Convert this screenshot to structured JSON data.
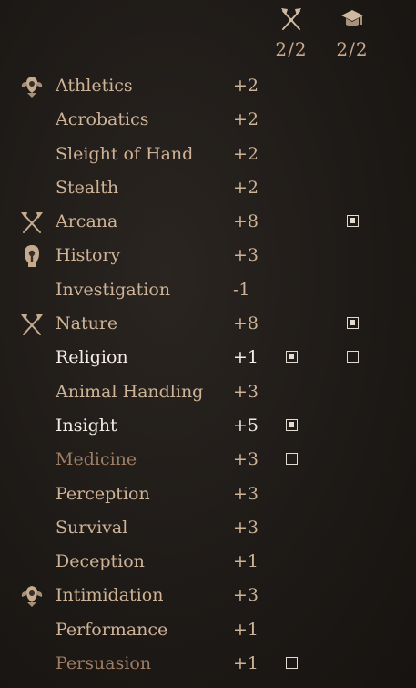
{
  "columns": {
    "class": {
      "icon": "crossed-axes-icon",
      "count": "2/2"
    },
    "background": {
      "icon": "graduation-cap-icon",
      "count": "2/2"
    }
  },
  "skills": [
    {
      "name": "Athletics",
      "modifier": "+2",
      "icon": "strength-crest-icon",
      "state": "normal",
      "class_box": "none",
      "background_box": "none"
    },
    {
      "name": "Acrobatics",
      "modifier": "+2",
      "icon": "",
      "state": "normal",
      "class_box": "none",
      "background_box": "none"
    },
    {
      "name": "Sleight of Hand",
      "modifier": "+2",
      "icon": "",
      "state": "normal",
      "class_box": "none",
      "background_box": "none"
    },
    {
      "name": "Stealth",
      "modifier": "+2",
      "icon": "",
      "state": "normal",
      "class_box": "none",
      "background_box": "none"
    },
    {
      "name": "Arcana",
      "modifier": "+8",
      "icon": "crossed-axes-icon",
      "state": "normal",
      "class_box": "none",
      "background_box": "filled"
    },
    {
      "name": "History",
      "modifier": "+3",
      "icon": "keyhole-icon",
      "state": "normal",
      "class_box": "none",
      "background_box": "none"
    },
    {
      "name": "Investigation",
      "modifier": "-1",
      "icon": "",
      "state": "normal",
      "class_box": "none",
      "background_box": "none"
    },
    {
      "name": "Nature",
      "modifier": "+8",
      "icon": "crossed-axes-icon",
      "state": "normal",
      "class_box": "none",
      "background_box": "filled"
    },
    {
      "name": "Religion",
      "modifier": "+1",
      "icon": "",
      "state": "bright",
      "class_box": "filled",
      "background_box": "empty"
    },
    {
      "name": "Animal Handling",
      "modifier": "+3",
      "icon": "",
      "state": "normal",
      "class_box": "none",
      "background_box": "none"
    },
    {
      "name": "Insight",
      "modifier": "+5",
      "icon": "",
      "state": "bright",
      "class_box": "filled",
      "background_box": "none"
    },
    {
      "name": "Medicine",
      "modifier": "+3",
      "icon": "",
      "state": "dim",
      "class_box": "empty",
      "background_box": "none"
    },
    {
      "name": "Perception",
      "modifier": "+3",
      "icon": "",
      "state": "normal",
      "class_box": "none",
      "background_box": "none"
    },
    {
      "name": "Survival",
      "modifier": "+3",
      "icon": "",
      "state": "normal",
      "class_box": "none",
      "background_box": "none"
    },
    {
      "name": "Deception",
      "modifier": "+1",
      "icon": "",
      "state": "normal",
      "class_box": "none",
      "background_box": "none"
    },
    {
      "name": "Intimidation",
      "modifier": "+3",
      "icon": "strength-crest-icon",
      "state": "normal",
      "class_box": "none",
      "background_box": "none"
    },
    {
      "name": "Performance",
      "modifier": "+1",
      "icon": "",
      "state": "normal",
      "class_box": "none",
      "background_box": "none"
    },
    {
      "name": "Persuasion",
      "modifier": "+1",
      "icon": "",
      "state": "dim",
      "class_box": "empty",
      "background_box": "none"
    }
  ],
  "colors": {
    "text_normal": "#cfb396",
    "text_bright": "#f2ece4",
    "text_dim": "#9f7c62",
    "checkbox": "#e4dbd0"
  }
}
